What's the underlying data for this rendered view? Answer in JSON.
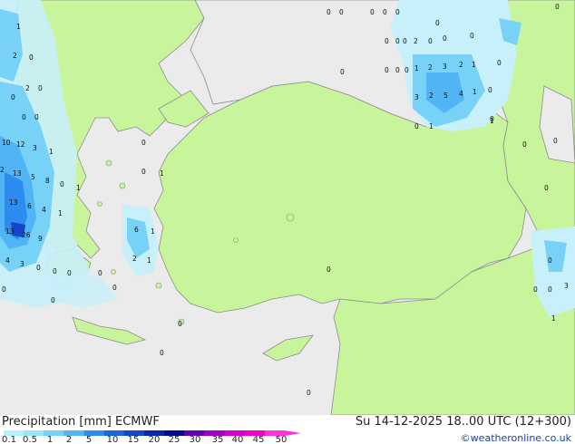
{
  "title_left": "Precipitation [mm] ECMWF",
  "title_right": "Su 14-12-2025 18..00 UTC (12+300)",
  "credit": "©weatheronline.co.uk",
  "legend": {
    "ticks": [
      "0.1",
      "0.5",
      "1",
      "2",
      "5",
      "10",
      "15",
      "20",
      "25",
      "30",
      "35",
      "40",
      "45",
      "50"
    ],
    "colors": [
      "#b4f0fa",
      "#96e6fa",
      "#78d2f8",
      "#50b4f5",
      "#2d8cf0",
      "#1e64dc",
      "#1446c8",
      "#0a28aa",
      "#000a8c",
      "#6400b4",
      "#a000c8",
      "#d200c8",
      "#f000c8",
      "#ff32dc"
    ]
  },
  "colors": {
    "land": "#c8f59b",
    "sea": "#ebebeb",
    "coast": "#8c8c8c",
    "rain_light": "#c8f0fa",
    "rain_mid": "#78d2f8",
    "rain_heavy": "#2d8cf0"
  },
  "map_values": {
    "top_right": [
      "0",
      "0",
      "0",
      "0",
      "0",
      "0",
      "0",
      "0",
      "0",
      "0",
      "0",
      "2",
      "0",
      "0",
      "0",
      "0",
      "0",
      "0",
      "1",
      "2",
      "3",
      "2",
      "1",
      "0",
      "3",
      "2",
      "5",
      "4",
      "1",
      "0",
      "0",
      "1",
      "0",
      "0",
      "0"
    ],
    "west": [
      "1",
      "2",
      "0",
      "2",
      "0",
      "0",
      "0",
      "0",
      "10",
      "12",
      "3",
      "1",
      "2",
      "13",
      "5",
      "8",
      "0",
      "1",
      "13",
      "6",
      "4",
      "1",
      "13",
      "26",
      "9",
      "4",
      "3",
      "0",
      "0",
      "0",
      "0",
      "0",
      "0",
      "0",
      "6",
      "1",
      "2",
      "1",
      "0",
      "0",
      "0",
      "0",
      "1",
      "0"
    ],
    "east": [
      "0",
      "0",
      "0",
      "1",
      "3",
      "1",
      "0",
      "0"
    ]
  }
}
